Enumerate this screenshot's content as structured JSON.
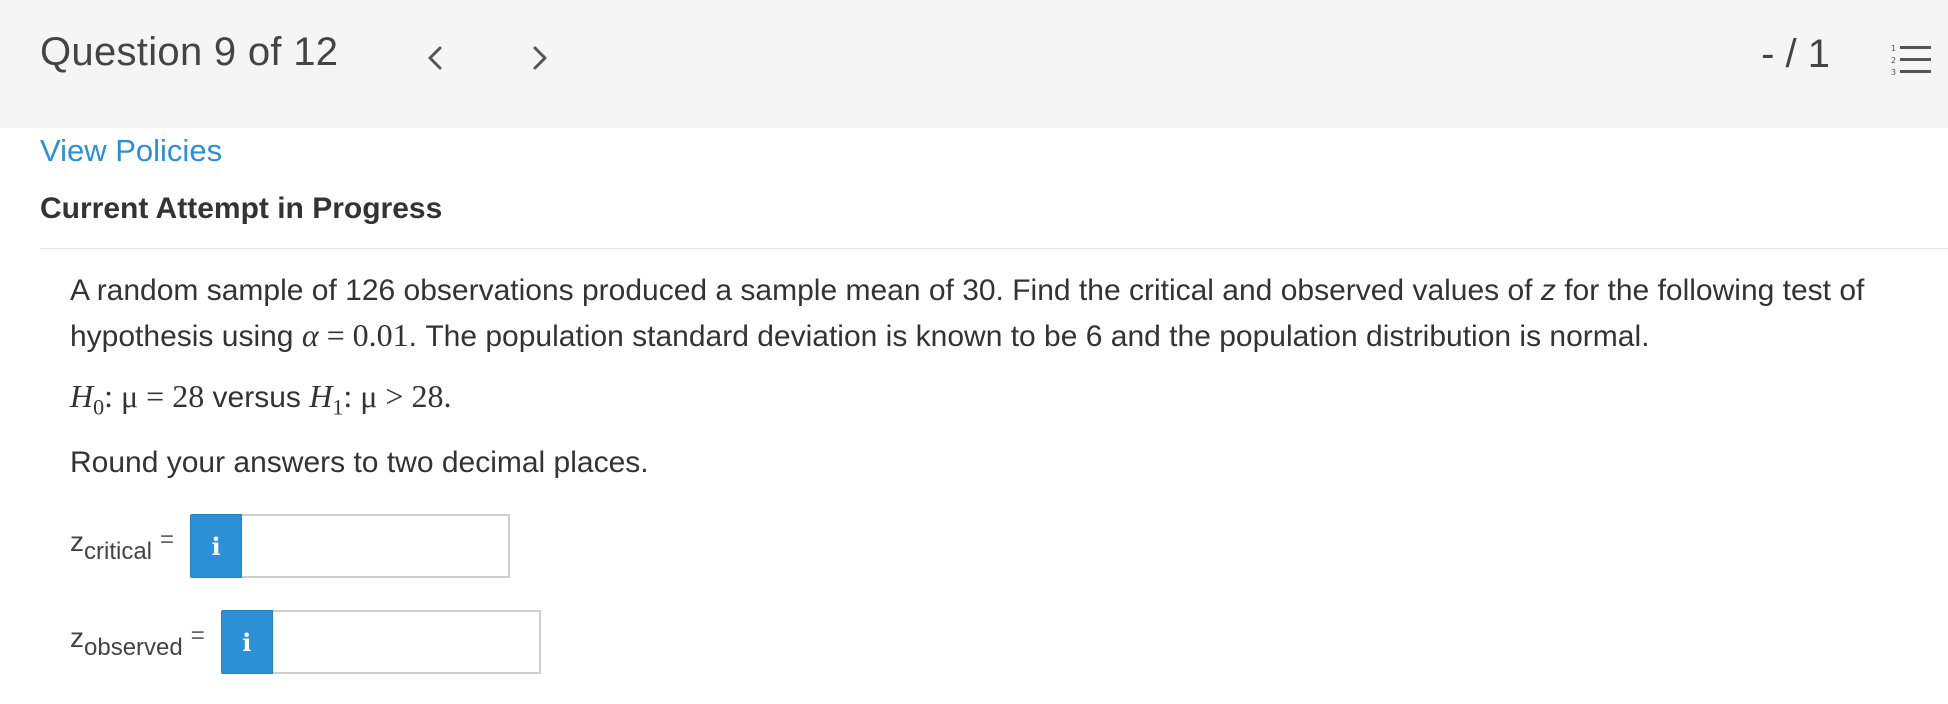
{
  "header": {
    "question_label": "Question 9 of 12",
    "score": "- / 1",
    "prev_icon": "chevron-left-icon",
    "next_icon": "chevron-right-icon",
    "list_icon": "numbered-list-icon"
  },
  "links": {
    "view_policies": "View Policies"
  },
  "attempt": {
    "title": "Current Attempt in Progress"
  },
  "question": {
    "text_part1": "A random sample of 126 observations produced a sample mean of 30. Find the critical and observed values of ",
    "z_var": "z",
    "text_part2": " for the following test of hypothesis using ",
    "alpha": "α",
    "alpha_eq": " = 0.01",
    "text_part3": ". The population standard deviation is known to be 6 and the population distribution is normal.",
    "hyp_h0": "H",
    "hyp_h0_sub": "0",
    "hyp_mid1": ": μ = 28",
    "hyp_versus": " versus ",
    "hyp_h1": "H",
    "hyp_h1_sub": "1",
    "hyp_mid2": ": μ > 28.",
    "round_instruction": "Round your answers to two decimal places."
  },
  "answers": [
    {
      "z": "z",
      "sub": "critical",
      "eq": "=",
      "info": "i",
      "value": ""
    },
    {
      "z": "z",
      "sub": "observed",
      "eq": "=",
      "info": "i",
      "value": ""
    }
  ],
  "colors": {
    "link": "#2d8fd5",
    "info_button": "#2d8fd5",
    "header_bg": "#f5f5f5"
  }
}
